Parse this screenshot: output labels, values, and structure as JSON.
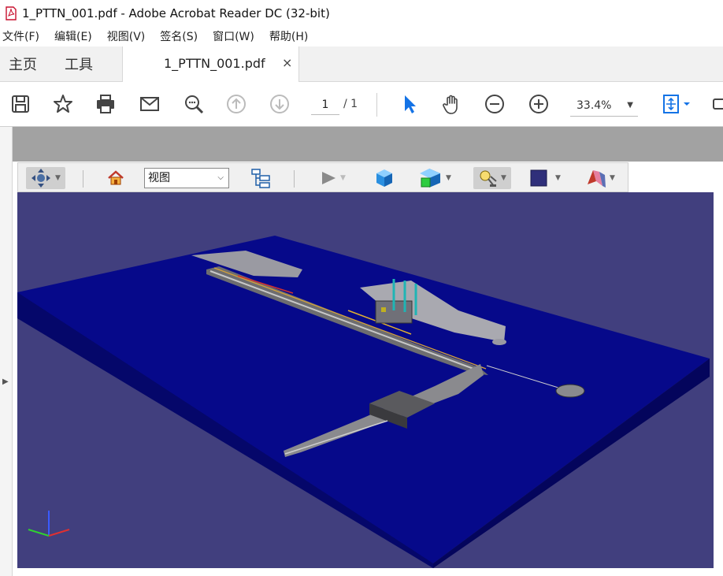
{
  "window": {
    "title": "1_PTTN_001.pdf - Adobe Acrobat Reader DC (32-bit)"
  },
  "menu": {
    "items": [
      "文件(F)",
      "编辑(E)",
      "视图(V)",
      "签名(S)",
      "窗口(W)",
      "帮助(H)"
    ]
  },
  "tabs": {
    "home": "主页",
    "tools": "工具",
    "document": "1_PTTN_001.pdf",
    "close": "×"
  },
  "toolbar": {
    "current_page": "1",
    "page_total": "/ 1",
    "zoom": "33.4%",
    "icons": [
      "save-icon",
      "star-icon",
      "print-icon",
      "mail-icon",
      "search-zoom-icon",
      "page-up-icon",
      "page-down-icon",
      "select-cursor-icon",
      "hand-icon",
      "zoom-out-icon",
      "zoom-in-icon",
      "fit-page-icon"
    ],
    "accent_color": "#1473e6"
  },
  "toolbar3d": {
    "view_select_value": "视图",
    "icons": [
      "rotate-tool-icon",
      "home-view-icon",
      "model-tree-icon",
      "play-animation-icon",
      "render-mode-icon",
      "lighting-icon",
      "projection-icon",
      "background-color-icon",
      "cross-section-icon"
    ]
  },
  "viewport": {
    "background_color": "#413f7e",
    "sea_color": "#0b0e8f",
    "axes": [
      "x",
      "y",
      "z"
    ]
  }
}
